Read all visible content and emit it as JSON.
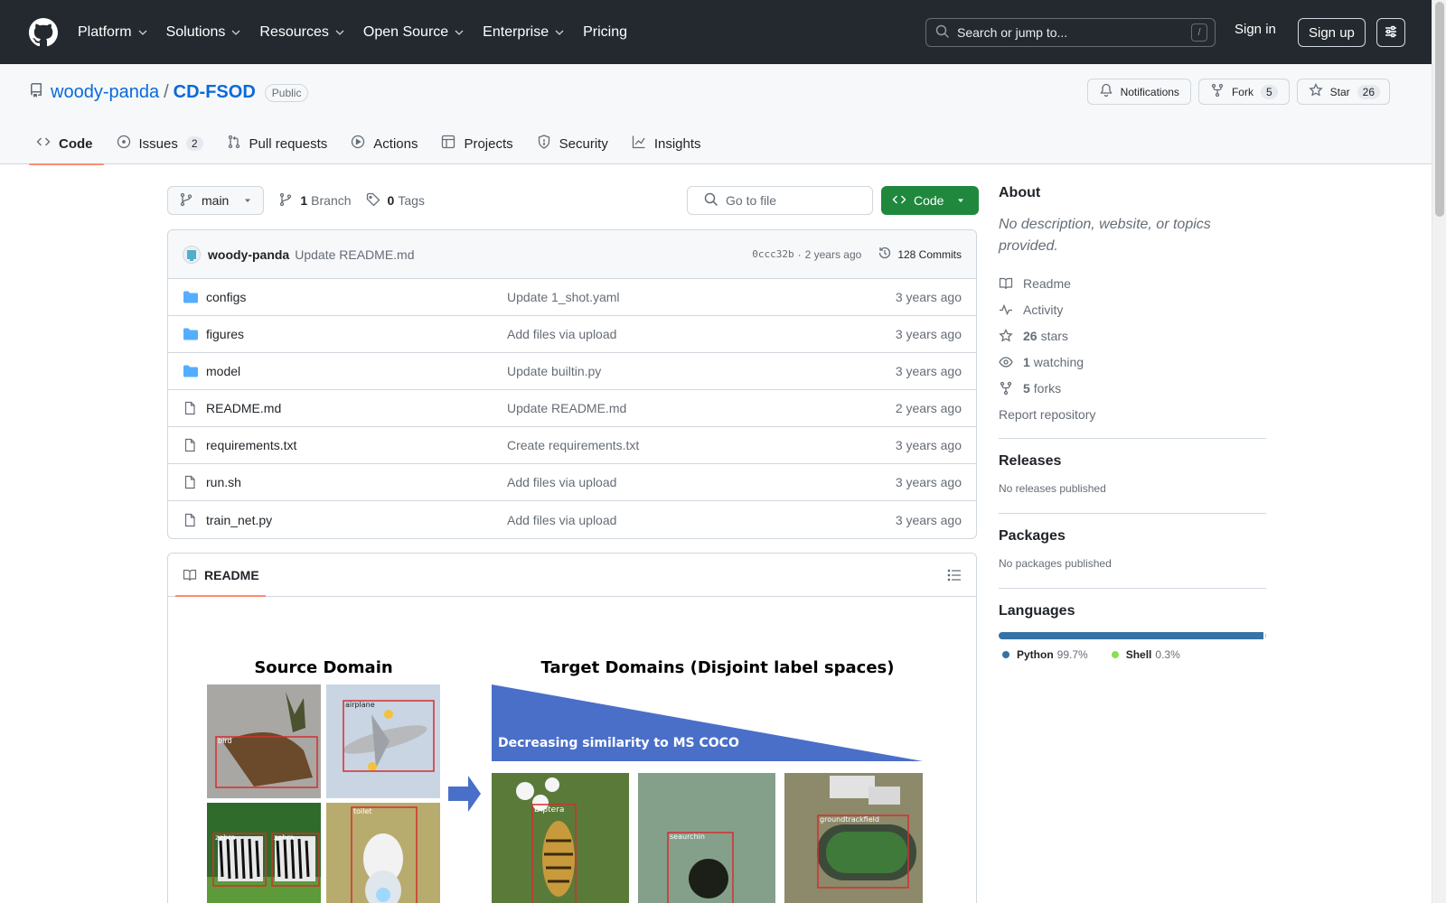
{
  "header": {
    "nav": [
      "Platform",
      "Solutions",
      "Resources",
      "Open Source",
      "Enterprise",
      "Pricing"
    ],
    "search_placeholder": "Search or jump to...",
    "search_shortcut": "/",
    "sign_in": "Sign in",
    "sign_up": "Sign up"
  },
  "repo": {
    "owner": "woody-panda",
    "separator": "/",
    "name": "CD-FSOD",
    "visibility": "Public",
    "notifications_label": "Notifications",
    "fork_label": "Fork",
    "fork_count": "5",
    "star_label": "Star",
    "star_count": "26"
  },
  "tabs": [
    {
      "label": "Code",
      "active": true
    },
    {
      "label": "Issues",
      "count": "2"
    },
    {
      "label": "Pull requests"
    },
    {
      "label": "Actions"
    },
    {
      "label": "Projects"
    },
    {
      "label": "Security"
    },
    {
      "label": "Insights"
    }
  ],
  "branch_bar": {
    "branch": "main",
    "branch_count": "1",
    "branch_label": "Branch",
    "tag_count": "0",
    "tag_label": "Tags",
    "go_to_file": "Go to file",
    "code_button": "Code"
  },
  "latest_commit": {
    "author": "woody-panda",
    "message": "Update README.md",
    "hash": "0ccc32b",
    "dot": "·",
    "age": "2 years ago",
    "commits_label": "128 Commits"
  },
  "files": [
    {
      "name": "configs",
      "type": "dir",
      "message": "Update 1_shot.yaml",
      "age": "3 years ago"
    },
    {
      "name": "figures",
      "type": "dir",
      "message": "Add files via upload",
      "age": "3 years ago"
    },
    {
      "name": "model",
      "type": "dir",
      "message": "Update builtin.py",
      "age": "3 years ago"
    },
    {
      "name": "README.md",
      "type": "file",
      "message": "Update README.md",
      "age": "2 years ago"
    },
    {
      "name": "requirements.txt",
      "type": "file",
      "message": "Create requirements.txt",
      "age": "3 years ago"
    },
    {
      "name": "run.sh",
      "type": "file",
      "message": "Add files via upload",
      "age": "3 years ago"
    },
    {
      "name": "train_net.py",
      "type": "file",
      "message": "Add files via upload",
      "age": "3 years ago"
    }
  ],
  "readme": {
    "title": "README",
    "figure": {
      "source_title": "Source Domain",
      "target_title": "Target Domains (Disjoint label spaces)",
      "wedge_text": "Decreasing similarity to MS COCO",
      "labels": [
        "bird",
        "airplane",
        "zebra",
        "zebra",
        "toilet",
        "Diptera",
        "seaurchin",
        "groundtrackfield"
      ]
    }
  },
  "sidebar": {
    "about_title": "About",
    "about_desc": "No description, website, or topics provided.",
    "links": [
      {
        "icon": "book-icon",
        "text": "Readme"
      },
      {
        "icon": "pulse-icon",
        "text": "Activity"
      },
      {
        "icon": "star-icon",
        "count": "26",
        "text": "stars"
      },
      {
        "icon": "eye-icon",
        "count": "1",
        "text": "watching"
      },
      {
        "icon": "fork-icon",
        "count": "5",
        "text": "forks"
      }
    ],
    "report": "Report repository",
    "releases_title": "Releases",
    "releases_text": "No releases published",
    "packages_title": "Packages",
    "packages_text": "No packages published",
    "languages_title": "Languages",
    "languages": [
      {
        "name": "Python",
        "percent": "99.7%",
        "value": 99.7,
        "color": "#3572A5"
      },
      {
        "name": "Shell",
        "percent": "0.3%",
        "value": 0.3,
        "color": "#89e051"
      }
    ]
  }
}
